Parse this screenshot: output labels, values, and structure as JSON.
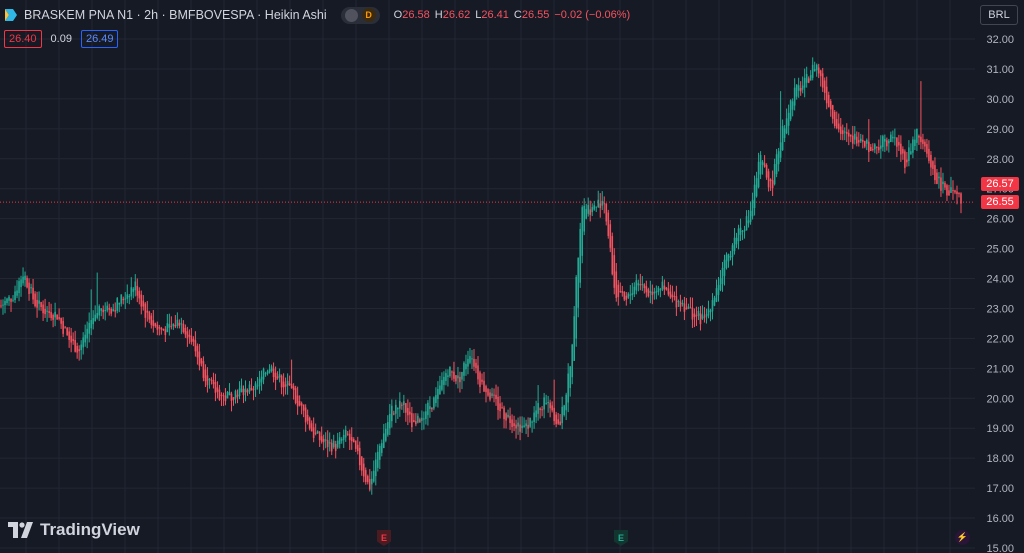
{
  "header": {
    "symbol": "BRASKEM PNA N1 · 2h · BMFBOVESPA · Heikin Ashi",
    "badge": "D",
    "ohlc": {
      "o_label": "O",
      "o": "26.58",
      "h_label": "H",
      "h": "26.62",
      "l_label": "L",
      "l": "26.41",
      "c_label": "C",
      "c": "26.55",
      "change": "−0.02 (−0.06%)"
    },
    "bid": "26.40",
    "spread": "0.09",
    "ask": "26.49"
  },
  "currency": "BRL",
  "price_tags": {
    "upper": "26.57",
    "lower": "26.55"
  },
  "branding": "TradingView",
  "events": [
    {
      "label": "E",
      "color": "#f23645"
    },
    {
      "label": "E",
      "color": "#22ab94"
    },
    {
      "label": "⚡",
      "color": "#b33eef"
    }
  ],
  "colors": {
    "up": "#22ab94",
    "down": "#f7525f",
    "background": "#161a25",
    "grid": "#232733",
    "axis_text": "#b2b5be",
    "price_line": "#f23645"
  },
  "chart_data": {
    "type": "candlestick",
    "chart_style": "Heikin Ashi",
    "interval": "2h",
    "y_axis_side": "right",
    "ylim": [
      15,
      32.4
    ],
    "y_ticks": [
      "32.00",
      "31.00",
      "30.00",
      "29.00",
      "28.00",
      "27.00",
      "26.00",
      "25.00",
      "24.00",
      "23.00",
      "22.00",
      "21.00",
      "20.00",
      "19.00",
      "18.00",
      "17.00",
      "16.00",
      "15.00"
    ],
    "last_price": 26.55,
    "grid": true,
    "series_close_approx": [
      23.1,
      23.4,
      24.2,
      23.2,
      22.9,
      22.8,
      22.0,
      21.6,
      22.6,
      23.1,
      23.0,
      23.4,
      23.8,
      22.8,
      22.3,
      22.3,
      22.6,
      22.0,
      21.0,
      20.3,
      20.0,
      20.2,
      20.3,
      20.4,
      21.1,
      20.6,
      20.3,
      19.6,
      18.8,
      18.5,
      18.4,
      18.8,
      18.0,
      17.0,
      18.5,
      19.6,
      19.8,
      19.0,
      19.6,
      20.0,
      21.0,
      20.6,
      21.6,
      20.5,
      20.0,
      19.5,
      19.2,
      19.0,
      19.6,
      20.0,
      19.0,
      21.0,
      26.5,
      26.3,
      26.7,
      23.5,
      23.2,
      24.0,
      23.5,
      23.8,
      23.3,
      23.2,
      22.8,
      22.6,
      23.6,
      24.6,
      25.6,
      26.0,
      28.0,
      27.0,
      29.0,
      30.2,
      30.5,
      31.2,
      30.0,
      29.0,
      28.6,
      28.8,
      28.3,
      28.6,
      28.7,
      27.9,
      28.9,
      28.0,
      27.2,
      26.9,
      26.55
    ]
  }
}
